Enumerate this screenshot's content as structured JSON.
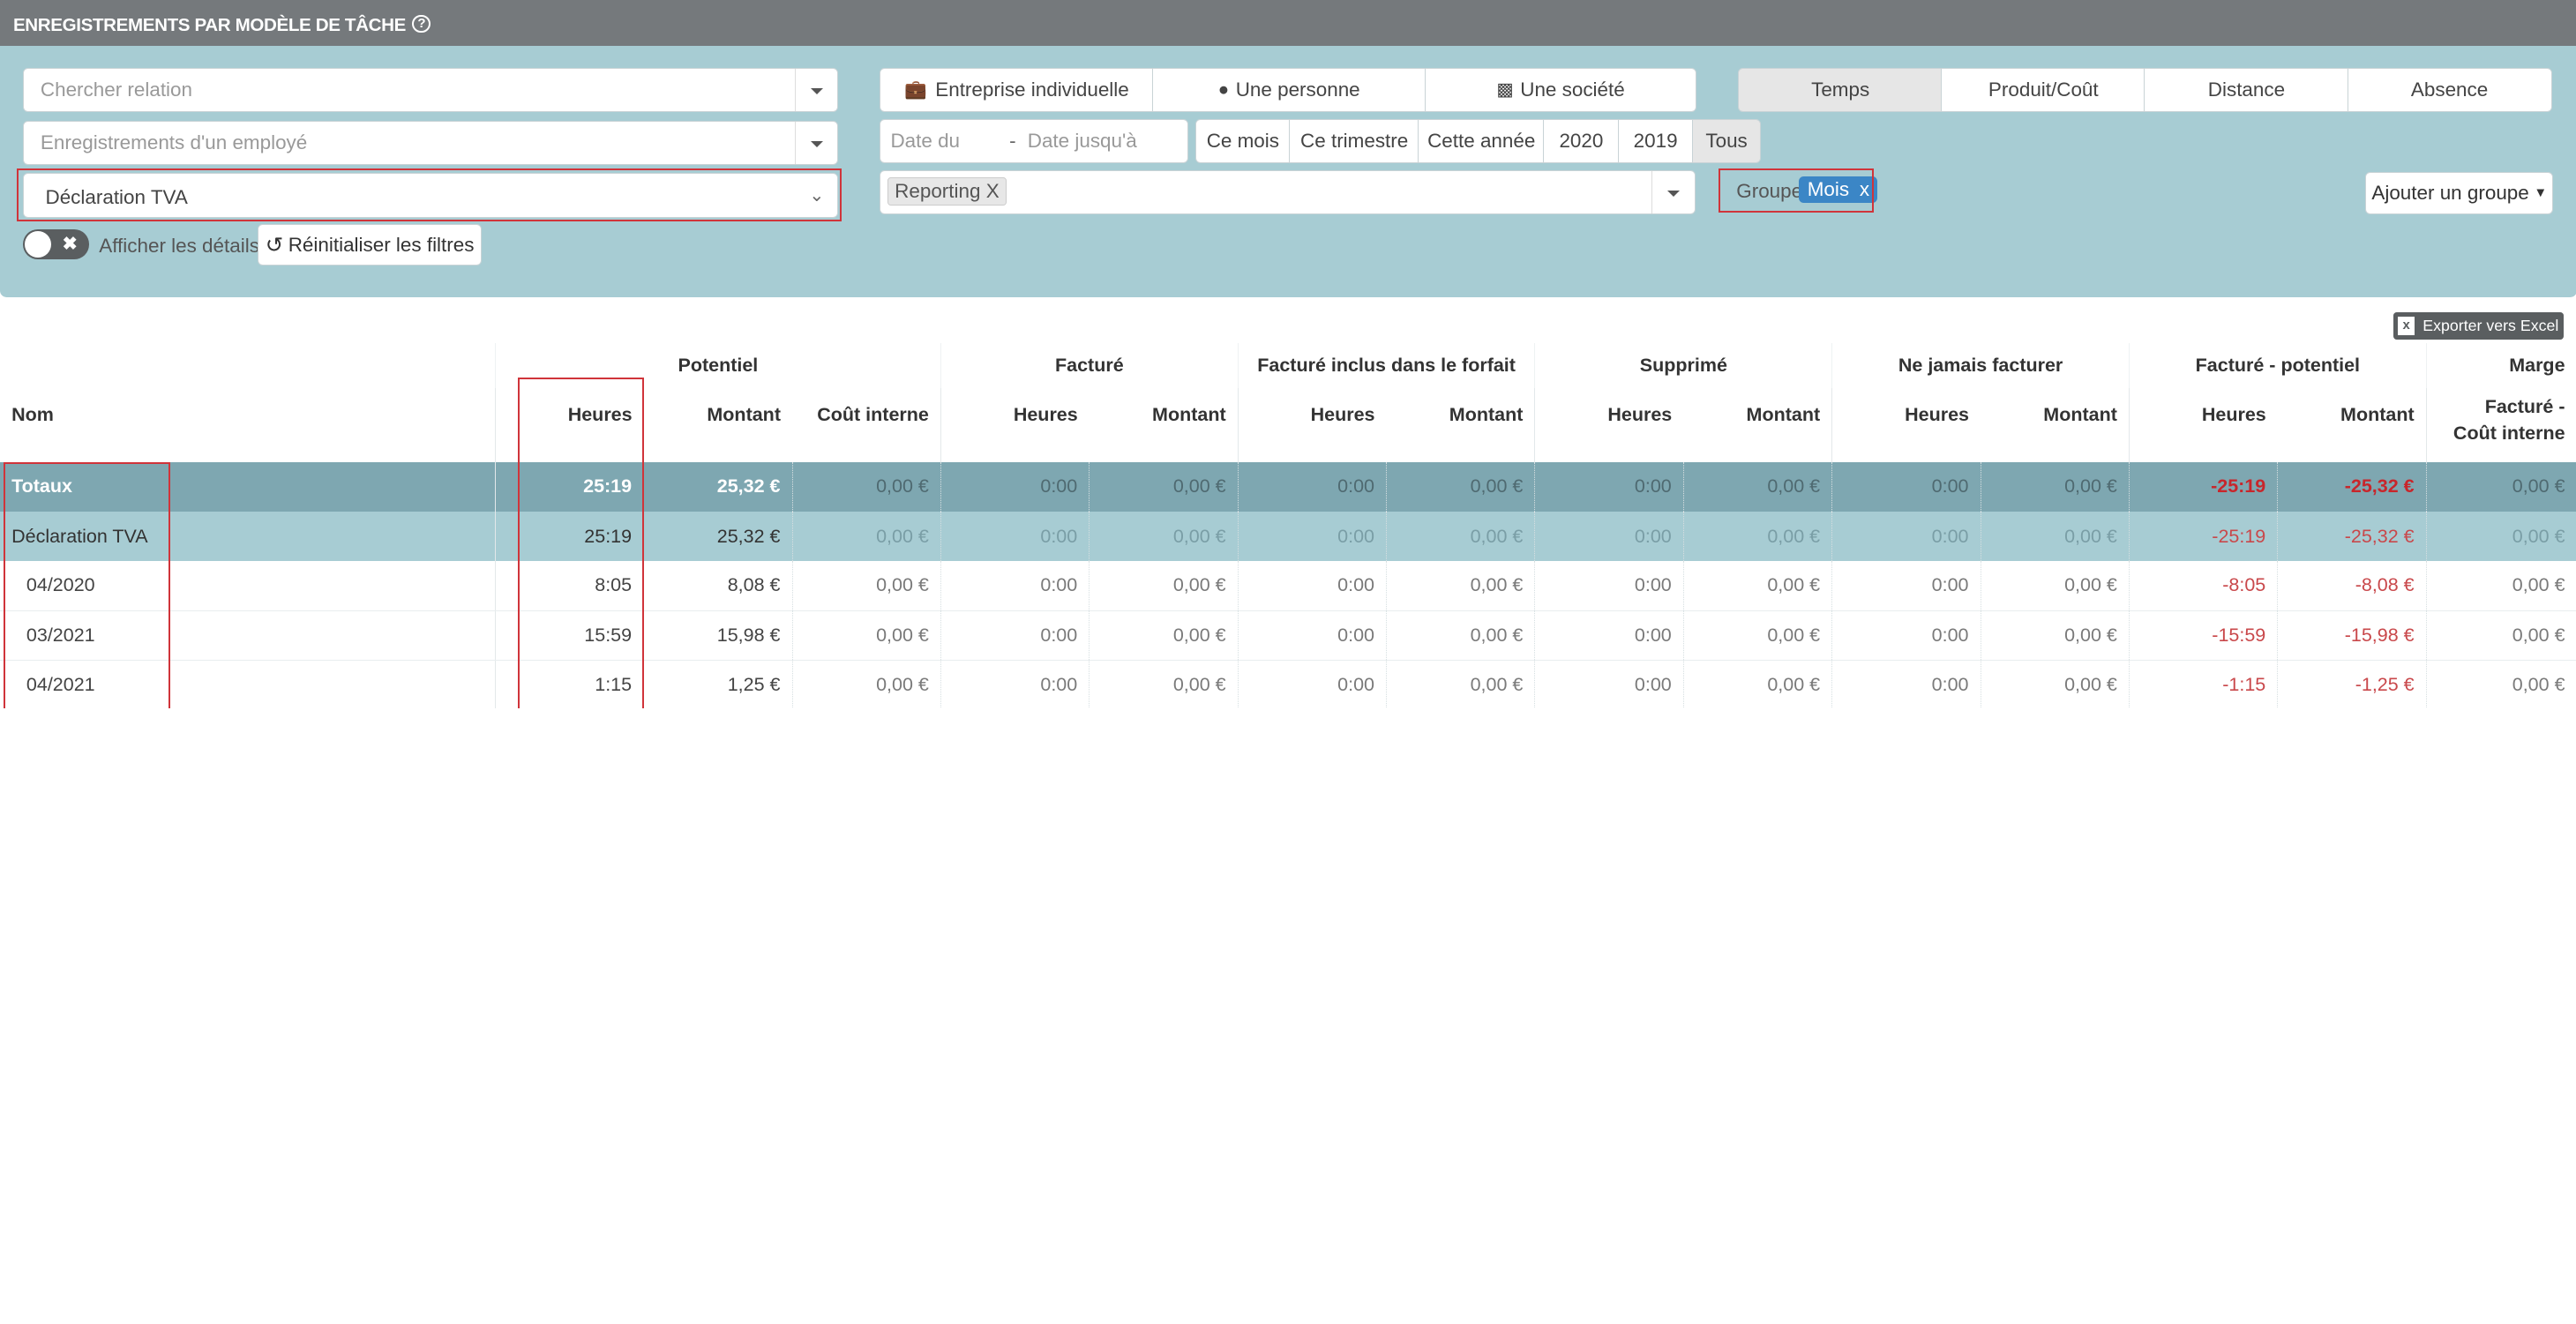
{
  "title": "ENREGISTREMENTS PAR MODÈLE DE TÂCHE",
  "filters": {
    "relation_placeholder": "Chercher relation",
    "employee_placeholder": "Enregistrements d'un employé",
    "task_model_value": "Déclaration TVA",
    "entity_types": [
      "Entreprise individuelle",
      "Une personne",
      "Une société"
    ],
    "measures": [
      "Temps",
      "Produit/Coût",
      "Distance",
      "Absence"
    ],
    "measure_active": "Temps",
    "date_from_placeholder": "Date du",
    "date_sep": "-",
    "date_to_placeholder": "Date jusqu'à",
    "periods": [
      "Ce mois",
      "Ce trimestre",
      "Cette année",
      "2020",
      "2019",
      "Tous"
    ],
    "period_active": "Tous",
    "reporting_tag": "Reporting X",
    "group_label": "Groupe",
    "group_tag": "Mois",
    "group_tag_remove": "x",
    "add_group": "Ajouter un groupe",
    "toggle_x": "✖",
    "show_details": "Afficher les détails",
    "reset_filters": "Réinitialiser les filtres"
  },
  "export_label": "Exporter vers Excel",
  "table": {
    "group_headers": [
      "Potentiel",
      "Facturé",
      "Facturé inclus dans le forfait",
      "Supprimé",
      "Ne jamais facturer",
      "Facturé - potentiel",
      "Marge"
    ],
    "columns": [
      "Nom",
      "Heures",
      "Montant",
      "Coût interne",
      "Heures",
      "Montant",
      "Heures",
      "Montant",
      "Heures",
      "Montant",
      "Heures",
      "Montant",
      "Heures",
      "Montant",
      "Facturé - Coût interne"
    ],
    "totals": [
      "Totaux",
      "25:19",
      "25,32 €",
      "0,00 €",
      "0:00",
      "0,00 €",
      "0:00",
      "0,00 €",
      "0:00",
      "0,00 €",
      "0:00",
      "0,00 €",
      "-25:19",
      "-25,32 €",
      "0,00 €"
    ],
    "group_row": [
      "Déclaration TVA",
      "25:19",
      "25,32 €",
      "0,00 €",
      "0:00",
      "0,00 €",
      "0:00",
      "0,00 €",
      "0:00",
      "0,00 €",
      "0:00",
      "0,00 €",
      "-25:19",
      "-25,32 €",
      "0,00 €"
    ],
    "rows": [
      [
        "04/2020",
        "8:05",
        "8,08 €",
        "0,00 €",
        "0:00",
        "0,00 €",
        "0:00",
        "0,00 €",
        "0:00",
        "0,00 €",
        "0:00",
        "0,00 €",
        "-8:05",
        "-8,08 €",
        "0,00 €"
      ],
      [
        "03/2021",
        "15:59",
        "15,98 €",
        "0,00 €",
        "0:00",
        "0,00 €",
        "0:00",
        "0,00 €",
        "0:00",
        "0,00 €",
        "0:00",
        "0,00 €",
        "-15:59",
        "-15,98 €",
        "0,00 €"
      ],
      [
        "04/2021",
        "1:15",
        "1,25 €",
        "0,00 €",
        "0:00",
        "0,00 €",
        "0:00",
        "0,00 €",
        "0:00",
        "0,00 €",
        "0:00",
        "0,00 €",
        "-1:15",
        "-1,25 €",
        "0,00 €"
      ]
    ]
  },
  "colors": {
    "header_bar": "#75797c",
    "filter_bg": "#a7ccd3",
    "totals_bg": "#7ea7b1",
    "group_bg": "#a7ccd3",
    "negative": "#c9484b",
    "highlight": "#d0343a",
    "tag_blue": "#3b86c6"
  }
}
